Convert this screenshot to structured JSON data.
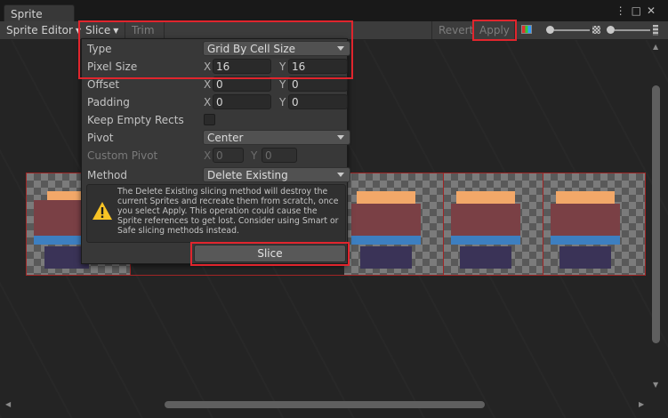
{
  "window": {
    "tab_title": "Sprite Editor",
    "controls": [
      "⋮",
      "□",
      "✕"
    ]
  },
  "toolbar": {
    "mode_dropdown": "Sprite Editor",
    "slice_menu": "Slice",
    "trim": "Trim",
    "revert": "Revert",
    "apply": "Apply",
    "color_toggle_icon": "rgb-channel-icon",
    "alpha_icon": "alpha-checker-icon",
    "mip_icon": "mip-level-icon",
    "zoom_icon": "zoom-icon"
  },
  "slice_panel": {
    "type": {
      "label": "Type",
      "value": "Grid By Cell Size"
    },
    "pixel_size": {
      "label": "Pixel Size",
      "x_label": "X",
      "x": "16",
      "y_label": "Y",
      "y": "16"
    },
    "offset": {
      "label": "Offset",
      "x_label": "X",
      "x": "0",
      "y_label": "Y",
      "y": "0"
    },
    "padding": {
      "label": "Padding",
      "x_label": "X",
      "x": "0",
      "y_label": "Y",
      "y": "0"
    },
    "keep_empty_rects": {
      "label": "Keep Empty Rects",
      "checked": false
    },
    "pivot": {
      "label": "Pivot",
      "value": "Center"
    },
    "custom_pivot": {
      "label": "Custom Pivot",
      "x_label": "X",
      "x": "0",
      "y_label": "Y",
      "y": "0"
    },
    "method": {
      "label": "Method",
      "value": "Delete Existing"
    },
    "help_box": {
      "icon": "warning-icon",
      "text": "The Delete Existing slicing method will destroy the current Sprites and recreate them from scratch, once you select Apply. This operation could cause the Sprite references to get lost. Consider using Smart or Safe slicing methods instead."
    },
    "slice_button": "Slice"
  },
  "colors": {
    "highlight": "#e0252d",
    "sprite_outline": "#a02525",
    "warning": "#f7c325"
  }
}
